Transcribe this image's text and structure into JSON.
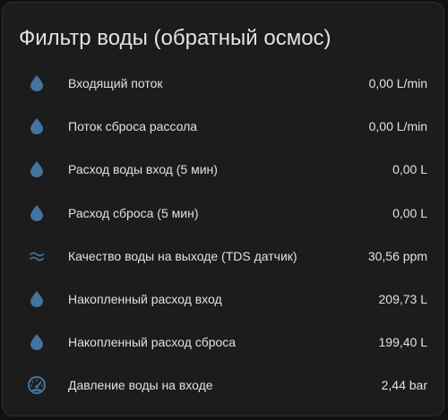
{
  "card": {
    "title": "Фильтр воды (обратный осмос)"
  },
  "colors": {
    "icon": "#44739e",
    "text": "#e1e1e1",
    "card_bg": "#1c1c1c"
  },
  "entities": [
    {
      "icon": "water-drop-icon",
      "label": "Входящий поток",
      "value": "0,00 L/min"
    },
    {
      "icon": "water-drop-icon",
      "label": "Поток сброса рассола",
      "value": "0,00 L/min"
    },
    {
      "icon": "water-drop-icon",
      "label": "Расход воды вход (5 мин)",
      "value": "0,00 L"
    },
    {
      "icon": "water-drop-icon",
      "label": "Расход сброса (5 мин)",
      "value": "0,00 L"
    },
    {
      "icon": "water-waves-icon",
      "label": "Качество воды на выходе (TDS датчик)",
      "value": "30,56 ppm"
    },
    {
      "icon": "water-drop-icon",
      "label": "Накопленный расход вход",
      "value": "209,73 L"
    },
    {
      "icon": "water-drop-icon",
      "label": "Накопленный расход сброса",
      "value": "199,40 L"
    },
    {
      "icon": "gauge-icon",
      "label": "Давление воды на входе",
      "value": "2,44 bar"
    }
  ]
}
